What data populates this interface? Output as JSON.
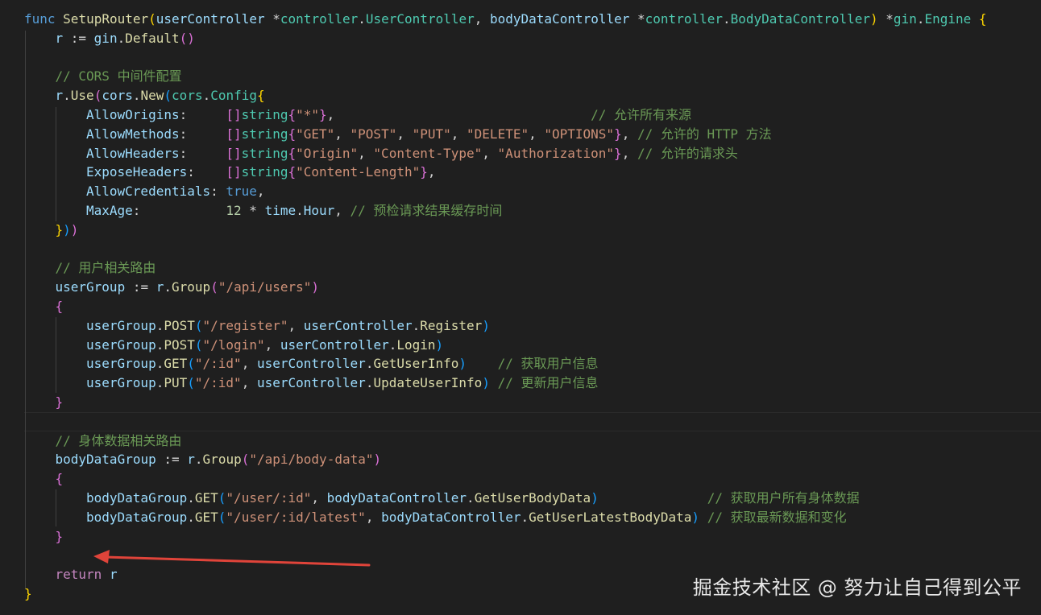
{
  "editor": {
    "lines": [
      {
        "indent": 0,
        "tokens": [
          {
            "t": "func",
            "c": "kw"
          },
          {
            "t": " ",
            "c": "op"
          },
          {
            "t": "SetupRouter",
            "c": "fn"
          },
          {
            "t": "(",
            "c": "b1"
          },
          {
            "t": "userController",
            "c": "var"
          },
          {
            "t": " *",
            "c": "op"
          },
          {
            "t": "controller",
            "c": "type"
          },
          {
            "t": ".",
            "c": "op"
          },
          {
            "t": "UserController",
            "c": "type"
          },
          {
            "t": ", ",
            "c": "op"
          },
          {
            "t": "bodyDataController",
            "c": "var"
          },
          {
            "t": " *",
            "c": "op"
          },
          {
            "t": "controller",
            "c": "type"
          },
          {
            "t": ".",
            "c": "op"
          },
          {
            "t": "BodyDataController",
            "c": "type"
          },
          {
            "t": ")",
            "c": "b1"
          },
          {
            "t": " *",
            "c": "op"
          },
          {
            "t": "gin",
            "c": "type"
          },
          {
            "t": ".",
            "c": "op"
          },
          {
            "t": "Engine",
            "c": "type"
          },
          {
            "t": " ",
            "c": "op"
          },
          {
            "t": "{",
            "c": "b1"
          }
        ]
      },
      {
        "indent": 1,
        "tokens": [
          {
            "t": "r",
            "c": "var"
          },
          {
            "t": " := ",
            "c": "op"
          },
          {
            "t": "gin",
            "c": "var"
          },
          {
            "t": ".",
            "c": "op"
          },
          {
            "t": "Default",
            "c": "fn"
          },
          {
            "t": "()",
            "c": "b2"
          }
        ]
      },
      {
        "indent": 0,
        "tokens": []
      },
      {
        "indent": 1,
        "tokens": [
          {
            "t": "// CORS 中间件配置",
            "c": "cm"
          }
        ]
      },
      {
        "indent": 1,
        "tokens": [
          {
            "t": "r",
            "c": "var"
          },
          {
            "t": ".",
            "c": "op"
          },
          {
            "t": "Use",
            "c": "fn"
          },
          {
            "t": "(",
            "c": "b2"
          },
          {
            "t": "cors",
            "c": "var"
          },
          {
            "t": ".",
            "c": "op"
          },
          {
            "t": "New",
            "c": "fn"
          },
          {
            "t": "(",
            "c": "b3"
          },
          {
            "t": "cors",
            "c": "type"
          },
          {
            "t": ".",
            "c": "op"
          },
          {
            "t": "Config",
            "c": "type"
          },
          {
            "t": "{",
            "c": "b1"
          }
        ]
      },
      {
        "indent": 2,
        "tokens": [
          {
            "t": "AllowOrigins",
            "c": "var"
          },
          {
            "t": ":     ",
            "c": "op"
          },
          {
            "t": "[]",
            "c": "b2"
          },
          {
            "t": "string",
            "c": "type"
          },
          {
            "t": "{",
            "c": "b2"
          },
          {
            "t": "\"*\"",
            "c": "str"
          },
          {
            "t": "}",
            "c": "b2"
          },
          {
            "t": ",                                 ",
            "c": "op"
          },
          {
            "t": "// 允许所有来源",
            "c": "cm"
          }
        ]
      },
      {
        "indent": 2,
        "tokens": [
          {
            "t": "AllowMethods",
            "c": "var"
          },
          {
            "t": ":     ",
            "c": "op"
          },
          {
            "t": "[]",
            "c": "b2"
          },
          {
            "t": "string",
            "c": "type"
          },
          {
            "t": "{",
            "c": "b2"
          },
          {
            "t": "\"GET\"",
            "c": "str"
          },
          {
            "t": ", ",
            "c": "op"
          },
          {
            "t": "\"POST\"",
            "c": "str"
          },
          {
            "t": ", ",
            "c": "op"
          },
          {
            "t": "\"PUT\"",
            "c": "str"
          },
          {
            "t": ", ",
            "c": "op"
          },
          {
            "t": "\"DELETE\"",
            "c": "str"
          },
          {
            "t": ", ",
            "c": "op"
          },
          {
            "t": "\"OPTIONS\"",
            "c": "str"
          },
          {
            "t": "}",
            "c": "b2"
          },
          {
            "t": ", ",
            "c": "op"
          },
          {
            "t": "// 允许的 HTTP 方法",
            "c": "cm"
          }
        ]
      },
      {
        "indent": 2,
        "tokens": [
          {
            "t": "AllowHeaders",
            "c": "var"
          },
          {
            "t": ":     ",
            "c": "op"
          },
          {
            "t": "[]",
            "c": "b2"
          },
          {
            "t": "string",
            "c": "type"
          },
          {
            "t": "{",
            "c": "b2"
          },
          {
            "t": "\"Origin\"",
            "c": "str"
          },
          {
            "t": ", ",
            "c": "op"
          },
          {
            "t": "\"Content-Type\"",
            "c": "str"
          },
          {
            "t": ", ",
            "c": "op"
          },
          {
            "t": "\"Authorization\"",
            "c": "str"
          },
          {
            "t": "}",
            "c": "b2"
          },
          {
            "t": ", ",
            "c": "op"
          },
          {
            "t": "// 允许的请求头",
            "c": "cm"
          }
        ]
      },
      {
        "indent": 2,
        "tokens": [
          {
            "t": "ExposeHeaders",
            "c": "var"
          },
          {
            "t": ":    ",
            "c": "op"
          },
          {
            "t": "[]",
            "c": "b2"
          },
          {
            "t": "string",
            "c": "type"
          },
          {
            "t": "{",
            "c": "b2"
          },
          {
            "t": "\"Content-Length\"",
            "c": "str"
          },
          {
            "t": "}",
            "c": "b2"
          },
          {
            "t": ",",
            "c": "op"
          }
        ]
      },
      {
        "indent": 2,
        "tokens": [
          {
            "t": "AllowCredentials",
            "c": "var"
          },
          {
            "t": ": ",
            "c": "op"
          },
          {
            "t": "true",
            "c": "kw"
          },
          {
            "t": ",",
            "c": "op"
          }
        ]
      },
      {
        "indent": 2,
        "tokens": [
          {
            "t": "MaxAge",
            "c": "var"
          },
          {
            "t": ":           ",
            "c": "op"
          },
          {
            "t": "12",
            "c": "num"
          },
          {
            "t": " * ",
            "c": "op"
          },
          {
            "t": "time",
            "c": "var"
          },
          {
            "t": ".",
            "c": "op"
          },
          {
            "t": "Hour",
            "c": "var"
          },
          {
            "t": ", ",
            "c": "op"
          },
          {
            "t": "// 预检请求结果缓存时间",
            "c": "cm"
          }
        ]
      },
      {
        "indent": 1,
        "tokens": [
          {
            "t": "}",
            "c": "b1"
          },
          {
            "t": ")",
            "c": "b3"
          },
          {
            "t": ")",
            "c": "b2"
          }
        ]
      },
      {
        "indent": 0,
        "tokens": []
      },
      {
        "indent": 1,
        "tokens": [
          {
            "t": "// 用户相关路由",
            "c": "cm"
          }
        ]
      },
      {
        "indent": 1,
        "tokens": [
          {
            "t": "userGroup",
            "c": "var"
          },
          {
            "t": " := ",
            "c": "op"
          },
          {
            "t": "r",
            "c": "var"
          },
          {
            "t": ".",
            "c": "op"
          },
          {
            "t": "Group",
            "c": "fn"
          },
          {
            "t": "(",
            "c": "b2"
          },
          {
            "t": "\"/api/users\"",
            "c": "str"
          },
          {
            "t": ")",
            "c": "b2"
          }
        ]
      },
      {
        "indent": 1,
        "tokens": [
          {
            "t": "{",
            "c": "b2"
          }
        ]
      },
      {
        "indent": 2,
        "tokens": [
          {
            "t": "userGroup",
            "c": "var"
          },
          {
            "t": ".",
            "c": "op"
          },
          {
            "t": "POST",
            "c": "fn"
          },
          {
            "t": "(",
            "c": "b3"
          },
          {
            "t": "\"/register\"",
            "c": "str"
          },
          {
            "t": ", ",
            "c": "op"
          },
          {
            "t": "userController",
            "c": "var"
          },
          {
            "t": ".",
            "c": "op"
          },
          {
            "t": "Register",
            "c": "fn"
          },
          {
            "t": ")",
            "c": "b3"
          }
        ]
      },
      {
        "indent": 2,
        "tokens": [
          {
            "t": "userGroup",
            "c": "var"
          },
          {
            "t": ".",
            "c": "op"
          },
          {
            "t": "POST",
            "c": "fn"
          },
          {
            "t": "(",
            "c": "b3"
          },
          {
            "t": "\"/login\"",
            "c": "str"
          },
          {
            "t": ", ",
            "c": "op"
          },
          {
            "t": "userController",
            "c": "var"
          },
          {
            "t": ".",
            "c": "op"
          },
          {
            "t": "Login",
            "c": "fn"
          },
          {
            "t": ")",
            "c": "b3"
          }
        ]
      },
      {
        "indent": 2,
        "tokens": [
          {
            "t": "userGroup",
            "c": "var"
          },
          {
            "t": ".",
            "c": "op"
          },
          {
            "t": "GET",
            "c": "fn"
          },
          {
            "t": "(",
            "c": "b3"
          },
          {
            "t": "\"/:id\"",
            "c": "str"
          },
          {
            "t": ", ",
            "c": "op"
          },
          {
            "t": "userController",
            "c": "var"
          },
          {
            "t": ".",
            "c": "op"
          },
          {
            "t": "GetUserInfo",
            "c": "fn"
          },
          {
            "t": ")",
            "c": "b3"
          },
          {
            "t": "    ",
            "c": "op"
          },
          {
            "t": "// 获取用户信息",
            "c": "cm"
          }
        ]
      },
      {
        "indent": 2,
        "tokens": [
          {
            "t": "userGroup",
            "c": "var"
          },
          {
            "t": ".",
            "c": "op"
          },
          {
            "t": "PUT",
            "c": "fn"
          },
          {
            "t": "(",
            "c": "b3"
          },
          {
            "t": "\"/:id\"",
            "c": "str"
          },
          {
            "t": ", ",
            "c": "op"
          },
          {
            "t": "userController",
            "c": "var"
          },
          {
            "t": ".",
            "c": "op"
          },
          {
            "t": "UpdateUserInfo",
            "c": "fn"
          },
          {
            "t": ")",
            "c": "b3"
          },
          {
            "t": " ",
            "c": "op"
          },
          {
            "t": "// 更新用户信息",
            "c": "cm"
          }
        ]
      },
      {
        "indent": 1,
        "tokens": [
          {
            "t": "}",
            "c": "b2"
          }
        ]
      },
      {
        "indent": 0,
        "tokens": []
      },
      {
        "indent": 1,
        "tokens": [
          {
            "t": "// 身体数据相关路由",
            "c": "cm"
          }
        ]
      },
      {
        "indent": 1,
        "tokens": [
          {
            "t": "bodyDataGroup",
            "c": "var"
          },
          {
            "t": " := ",
            "c": "op"
          },
          {
            "t": "r",
            "c": "var"
          },
          {
            "t": ".",
            "c": "op"
          },
          {
            "t": "Group",
            "c": "fn"
          },
          {
            "t": "(",
            "c": "b2"
          },
          {
            "t": "\"/api/body-data\"",
            "c": "str"
          },
          {
            "t": ")",
            "c": "b2"
          }
        ]
      },
      {
        "indent": 1,
        "tokens": [
          {
            "t": "{",
            "c": "b2"
          }
        ]
      },
      {
        "indent": 2,
        "tokens": [
          {
            "t": "bodyDataGroup",
            "c": "var"
          },
          {
            "t": ".",
            "c": "op"
          },
          {
            "t": "GET",
            "c": "fn"
          },
          {
            "t": "(",
            "c": "b3"
          },
          {
            "t": "\"/user/:id\"",
            "c": "str"
          },
          {
            "t": ", ",
            "c": "op"
          },
          {
            "t": "bodyDataController",
            "c": "var"
          },
          {
            "t": ".",
            "c": "op"
          },
          {
            "t": "GetUserBodyData",
            "c": "fn"
          },
          {
            "t": ")",
            "c": "b3"
          },
          {
            "t": "              ",
            "c": "op"
          },
          {
            "t": "// 获取用户所有身体数据",
            "c": "cm"
          }
        ]
      },
      {
        "indent": 2,
        "tokens": [
          {
            "t": "bodyDataGroup",
            "c": "var"
          },
          {
            "t": ".",
            "c": "op"
          },
          {
            "t": "GET",
            "c": "fn"
          },
          {
            "t": "(",
            "c": "b3"
          },
          {
            "t": "\"/user/:id/latest\"",
            "c": "str"
          },
          {
            "t": ", ",
            "c": "op"
          },
          {
            "t": "bodyDataController",
            "c": "var"
          },
          {
            "t": ".",
            "c": "op"
          },
          {
            "t": "GetUserLatestBodyData",
            "c": "fn"
          },
          {
            "t": ")",
            "c": "b3"
          },
          {
            "t": " ",
            "c": "op"
          },
          {
            "t": "// 获取最新数据和变化",
            "c": "cm"
          }
        ]
      },
      {
        "indent": 1,
        "tokens": [
          {
            "t": "}",
            "c": "b2"
          }
        ]
      },
      {
        "indent": 0,
        "tokens": []
      },
      {
        "indent": 1,
        "tokens": [
          {
            "t": "return",
            "c": "ctl"
          },
          {
            "t": " ",
            "c": "op"
          },
          {
            "t": "r",
            "c": "var"
          }
        ]
      },
      {
        "indent": 0,
        "tokens": [
          {
            "t": "}",
            "c": "b1"
          }
        ]
      }
    ]
  },
  "watermark": {
    "text": "掘金技术社区 @ 努力让自己得到公平"
  },
  "annotation": {
    "arrow_color": "#e0443a"
  },
  "theme": {
    "background": "#1f1f1f",
    "keyword": "#569cd6",
    "function": "#dcdcaa",
    "type": "#4ec9b0",
    "variable": "#9cdcfe",
    "string": "#ce9178",
    "comment": "#6a9955"
  }
}
